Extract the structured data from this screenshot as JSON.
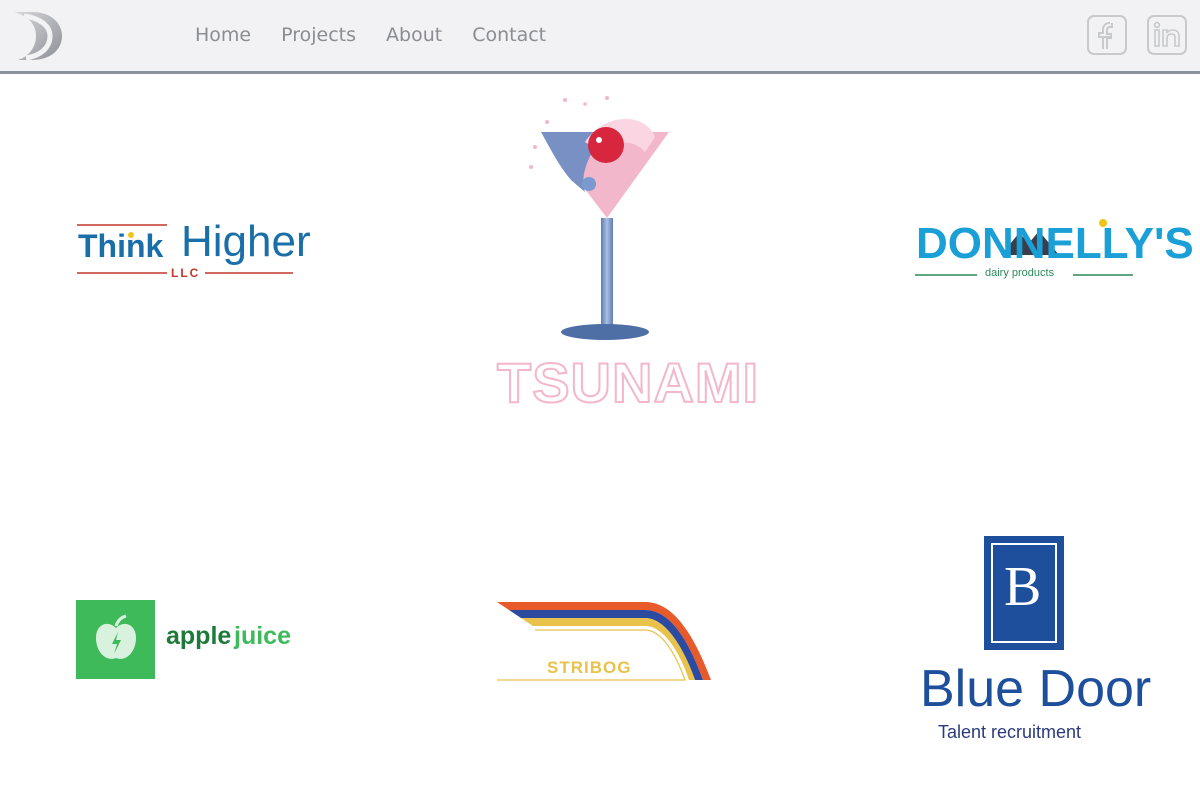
{
  "header": {
    "logo_icon": "stylized-d-logo-icon",
    "nav": [
      "Home",
      "Projects",
      "About",
      "Contact"
    ],
    "social": [
      {
        "icon": "facebook-icon",
        "glyph": "f"
      },
      {
        "icon": "linkedin-icon",
        "glyph": "in"
      }
    ]
  },
  "gallery": {
    "think_higher": {
      "name": "Think Higher",
      "word1": "Think",
      "word2": "Higher",
      "sub": "LLC"
    },
    "tsunami": {
      "name": "TSUNAMI"
    },
    "donnellys": {
      "name": "DONNELLY'S",
      "sub": "dairy products"
    },
    "applejuice": {
      "word1": "apple",
      "word2": "juice"
    },
    "stribog": {
      "name": "STRIBOG"
    },
    "bluedoor": {
      "letter": "B",
      "name": "Blue Door",
      "sub": "Talent recruitment"
    }
  },
  "colors": {
    "nav_text": "#8b8d92",
    "header_bg": "#f2f2f5",
    "header_border": "#8a939c",
    "think_blue": "#1b6fa8",
    "think_red": "#c0392b",
    "tsunami_pink": "#f3b6cb",
    "donnelly_blue": "#1a9fd6",
    "donnelly_green": "#2a8a5a",
    "apple_green": "#3fba5b",
    "apple_dark": "#1e7a3a",
    "stribog_yellow": "#e8c24a",
    "bluedoor_blue": "#1d4f9c",
    "bluedoor_navy": "#2b3a7a"
  }
}
